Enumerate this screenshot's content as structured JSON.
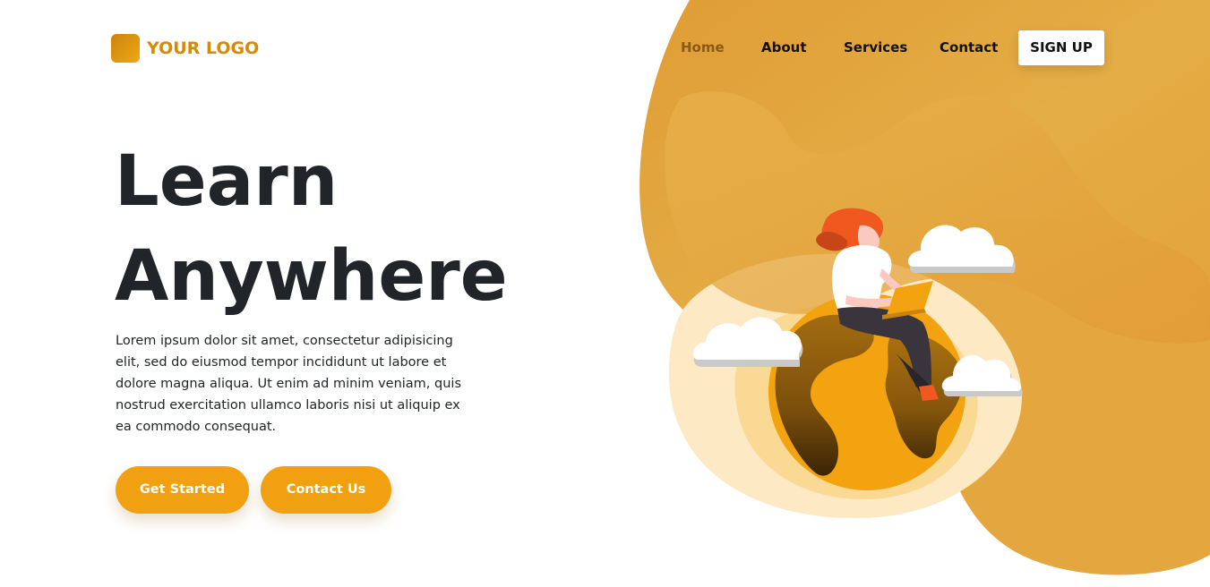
{
  "logo": {
    "text": "YOUR LOGO"
  },
  "nav": {
    "items": [
      {
        "label": "Home",
        "active": true
      },
      {
        "label": "About"
      },
      {
        "label": "Services"
      },
      {
        "label": "Contact"
      }
    ],
    "signup_label": "SIGN UP"
  },
  "hero": {
    "title_line1": "Learn",
    "title_line2": "Anywhere",
    "description": "Lorem ipsum dolor sit amet, consectetur adipisicing elit, sed do eiusmod tempor incididunt ut labore et dolore magna aliqua. Ut enim ad minim veniam, quis nostrud exercitation ullamco laboris nisi ut aliquip ex ea commodo consequat.",
    "primary_button": "Get Started",
    "secondary_button": "Contact Us"
  },
  "colors": {
    "accent": "#f0a010",
    "logo": "#d98a00",
    "text": "#212428",
    "active_nav": "#8a5a12"
  },
  "illustration": {
    "icons": [
      "blob-background",
      "globe-icon",
      "woman-with-laptop-icon",
      "cloud-icon"
    ]
  }
}
